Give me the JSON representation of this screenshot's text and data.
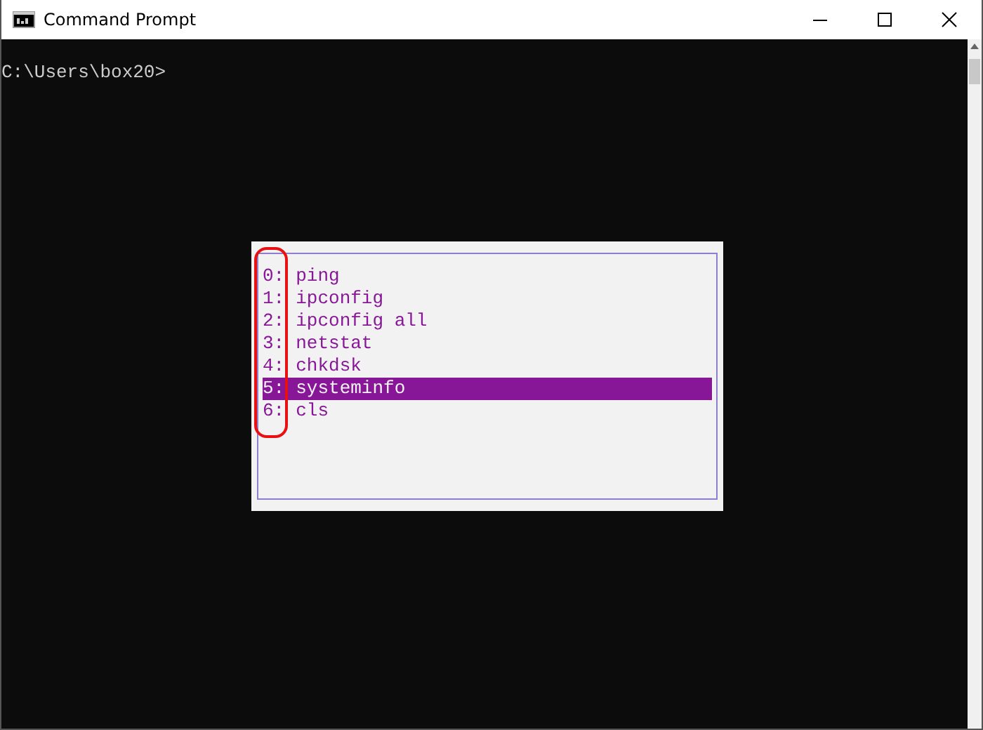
{
  "window": {
    "title": "Command Prompt"
  },
  "console": {
    "prompt": "C:\\Users\\box20>"
  },
  "history_popup": {
    "items": [
      {
        "number": "0:",
        "command": "ping",
        "selected": false
      },
      {
        "number": "1:",
        "command": "ipconfig",
        "selected": false
      },
      {
        "number": "2:",
        "command": "ipconfig all",
        "selected": false
      },
      {
        "number": "3:",
        "command": "netstat",
        "selected": false
      },
      {
        "number": "4:",
        "command": "chkdsk",
        "selected": false
      },
      {
        "number": "5:",
        "command": "systeminfo",
        "selected": true
      },
      {
        "number": "6:",
        "command": "cls",
        "selected": false
      }
    ]
  }
}
